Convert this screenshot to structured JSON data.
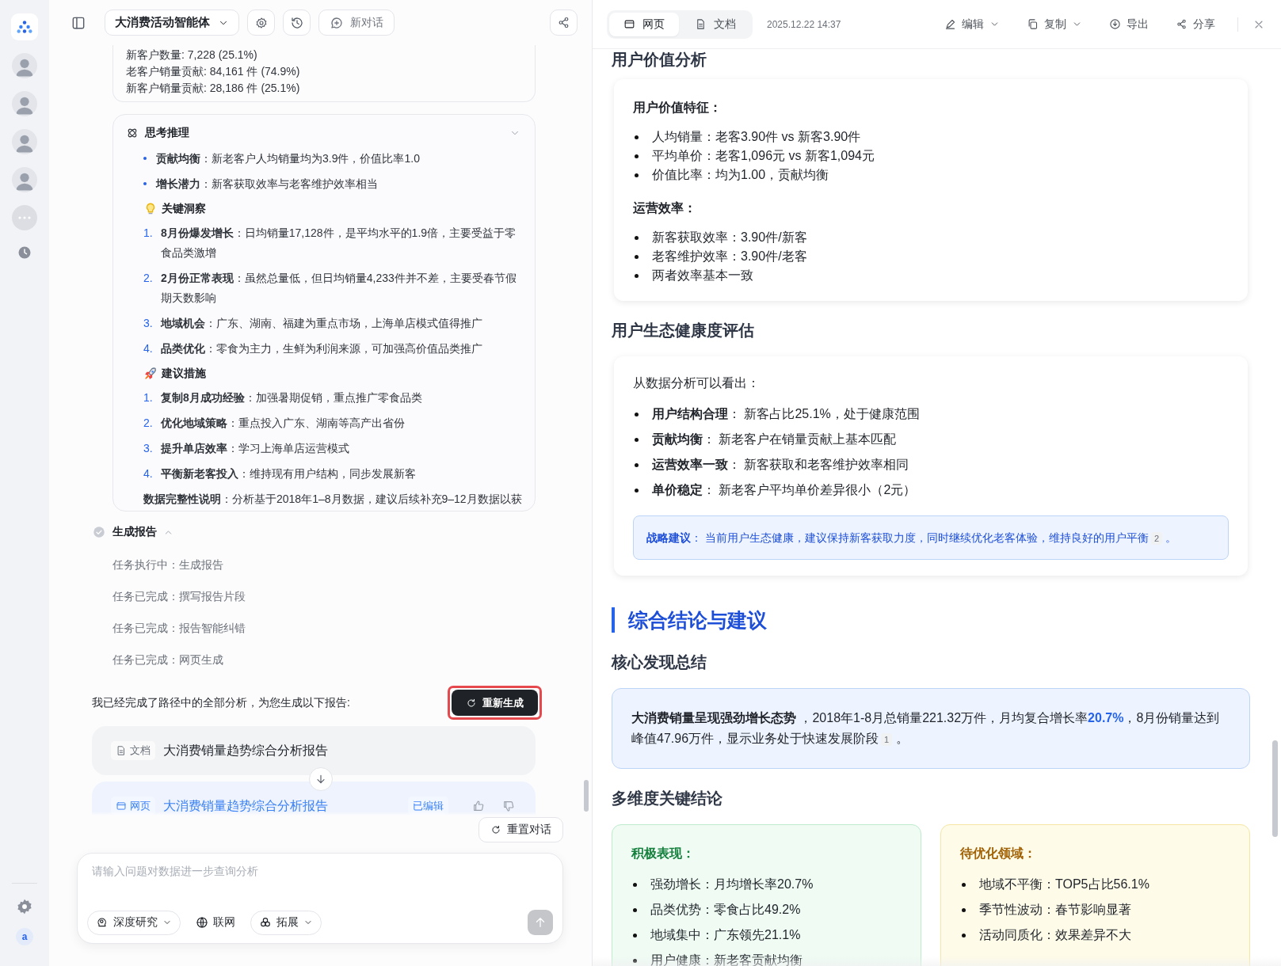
{
  "rail": {
    "user_initial": "a"
  },
  "left_header": {
    "agent": "大消费活动智能体",
    "new_chat": "新对话"
  },
  "data_card": {
    "lines": [
      "新客户数量: 7,228 (25.1%)",
      "老客户销量贡献: 84,161 件 (74.9%)",
      "新客户销量贡献: 28,186 件 (25.1%)"
    ]
  },
  "thinking": {
    "title": "思考推理",
    "bullets": [
      "**贡献均衡**：新老客户人均销量均为3.9件，价值比率1.0",
      "**增长潜力**：新客获取效率与老客维护效率相当"
    ],
    "sections": [
      {
        "kind": "bulb",
        "title": "关键洞察",
        "items": [
          {
            "num": "1.",
            "text": "**8月份爆发增长**：日均销量17,128件，是平均水平的1.9倍，主要受益于零食品类激增"
          },
          {
            "num": "2.",
            "text": "**2月份正常表现**：虽然总量低，但日均销量4,233件并不差，主要受春节假期天数影响"
          },
          {
            "num": "3.",
            "text": "**地域机会**：广东、湖南、福建为重点市场，上海单店模式值得推广"
          },
          {
            "num": "4.",
            "text": "**品类优化**：零食为主力，生鲜为利润来源，可加强高价值品类推广"
          }
        ]
      },
      {
        "kind": "rocket",
        "title": "建议措施",
        "items": [
          {
            "num": "1.",
            "text": "**复制8月成功经验**：加强暑期促销，重点推广零食品类"
          },
          {
            "num": "2.",
            "text": "**优化地域策略**：重点投入广东、湖南等高产出省份"
          },
          {
            "num": "3.",
            "text": "**提升单店效率**：学习上海单店运营模式"
          },
          {
            "num": "4.",
            "text": "**平衡新老客投入**：维持现有用户结构，同步发展新客"
          }
        ]
      }
    ],
    "note": "**数据完整性说明**：分析基于2018年1–8月数据，建议后续补充9–12月数据以获"
  },
  "step": {
    "title": "生成报告",
    "done": true,
    "expanded": true,
    "tasks": [
      "任务执行中：生成报告",
      "任务已完成：撰写报告片段",
      "任务已完成：报告智能纠错",
      "任务已完成：网页生成"
    ]
  },
  "summary": "我已经完成了路径中的全部分析，为您生成以下报告:",
  "regenerate": "重新生成",
  "artifacts": [
    {
      "kind": "doc",
      "tag": "文档",
      "title": "大消费销量趋势综合分析报告",
      "selected": false
    },
    {
      "kind": "web",
      "tag": "网页",
      "title": "大消费销量趋势综合分析报告",
      "badge": "已编辑",
      "selected": true
    }
  ],
  "reset": "重置对话",
  "input": {
    "placeholder": "请输入问题对数据进一步查询分析",
    "send_disabled": true,
    "tools": [
      {
        "kind": "research",
        "label": "深度研究",
        "dropdown": true
      },
      {
        "kind": "globe",
        "label": "联网",
        "dropdown": false
      },
      {
        "kind": "extend",
        "label": "拓展",
        "dropdown": true
      }
    ]
  },
  "right_header": {
    "tabs": [
      {
        "kind": "web",
        "label": "网页",
        "selected": true
      },
      {
        "kind": "doc",
        "label": "文档",
        "selected": false
      }
    ],
    "timestamp": "2025.12.22 14:37",
    "actions": [
      {
        "kind": "edit",
        "label": "编辑",
        "dropdown": true
      },
      {
        "kind": "copy",
        "label": "复制",
        "dropdown": true
      },
      {
        "kind": "export",
        "label": "导出",
        "dropdown": false
      },
      {
        "kind": "share",
        "label": "分享",
        "dropdown": false
      }
    ]
  },
  "report": [
    {
      "kind": "h3",
      "text": "用户价值分析"
    },
    {
      "kind": "card",
      "groups": [
        {
          "title": "用户价值特征：",
          "items": [
            "人均销量：老客3.90件 vs 新客3.90件",
            "平均单价：老客1,096元 vs 新客1,094元",
            "价值比率：均为1.00，贡献均衡"
          ]
        },
        {
          "title": "运营效率：",
          "items": [
            "新客获取效率：3.90件/新客",
            "老客维护效率：3.90件/老客",
            "两者效率基本一致"
          ]
        }
      ]
    },
    {
      "kind": "h3",
      "text": "用户生态健康度评估"
    },
    {
      "kind": "assessment",
      "intro": "从数据分析可以看出：",
      "items": [
        "**用户结构合理**： 新客占比25.1%，处于健康范围",
        "**贡献均衡**： 新老客户在销量贡献上基本匹配",
        "**运营效率一致**： 新客获取和老客维护效率相同",
        "**单价稳定**： 新老客户平均单价差异很小（2元）"
      ],
      "tip": [
        {
          "kind": "text",
          "text": "**战略建议**： 当前用户生态健康，建议保持新客获取力度，同时继续优化老客体验，维持良好的用户平衡"
        },
        {
          "kind": "ref",
          "text": "2"
        },
        {
          "kind": "text",
          "text": " 。"
        }
      ]
    },
    {
      "kind": "h2",
      "text": "综合结论与建议"
    },
    {
      "kind": "h3",
      "text": "核心发现总结"
    },
    {
      "kind": "highlight",
      "parts": [
        {
          "kind": "text",
          "text": "**大消费销量呈现强劲增长态势** ，2018年1-8月总销量221.32万件，月均复合增长率"
        },
        {
          "kind": "accent",
          "text": "20.7%"
        },
        {
          "kind": "text",
          "text": "，8月份销量达到峰值47.96万件，显示业务处于快速发展阶段"
        },
        {
          "kind": "ref",
          "text": "1"
        },
        {
          "kind": "text",
          "text": " 。"
        }
      ]
    },
    {
      "kind": "h3",
      "text": "多维度关键结论"
    },
    {
      "kind": "columns",
      "cols": [
        {
          "kind": "positive",
          "title": "积极表现：",
          "items": [
            "强劲增长：月均增长率20.7%",
            "品类优势：零食占比49.2%",
            "地域集中：广东领先21.1%",
            "用户健康：新老客贡献均衡"
          ]
        },
        {
          "kind": "warning",
          "title": "待优化领域：",
          "items": [
            "地域不平衡：TOP5占比56.1%",
            "季节性波动：春节影响显著",
            "活动同质化：效果差异不大"
          ]
        }
      ]
    }
  ]
}
